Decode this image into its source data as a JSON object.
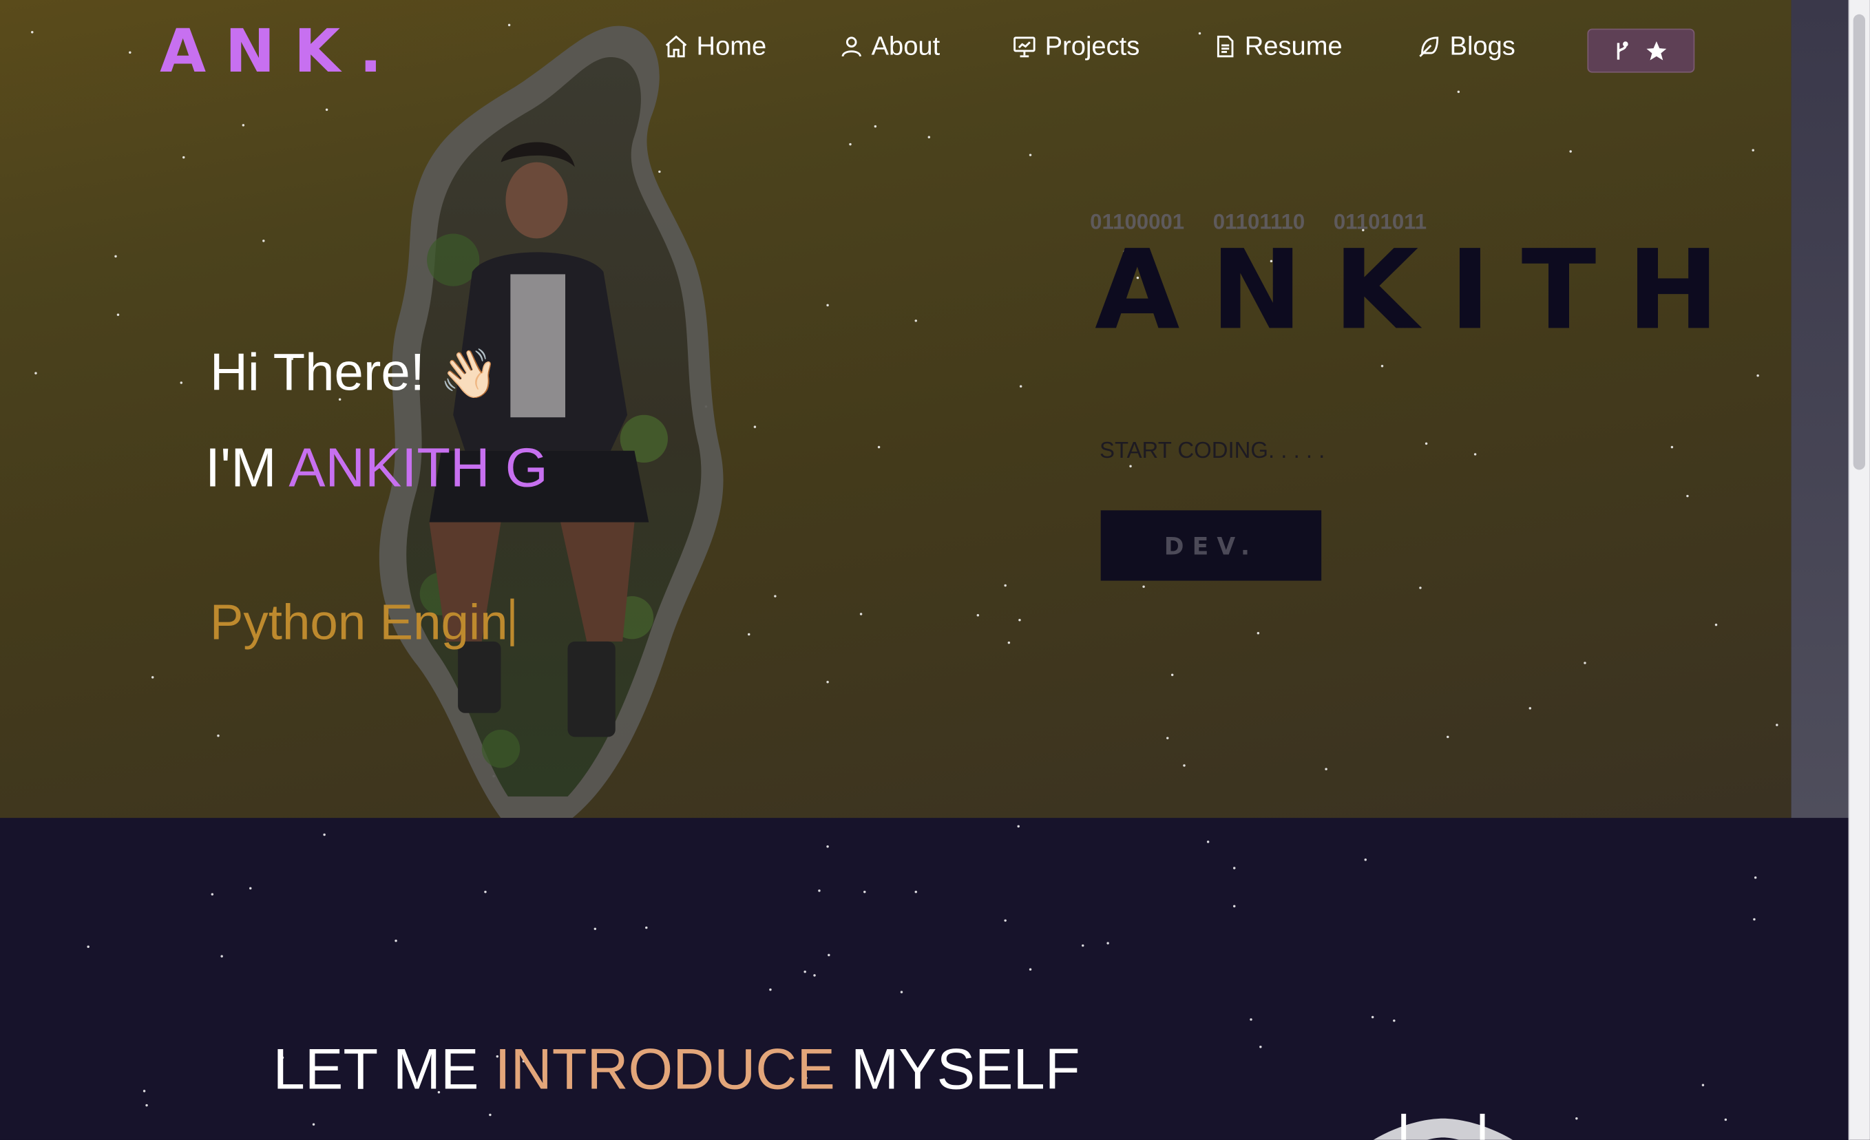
{
  "nav": {
    "logo": "ANK.",
    "items": [
      {
        "label": "Home",
        "icon": "home-icon"
      },
      {
        "label": "About",
        "icon": "user-icon"
      },
      {
        "label": "Projects",
        "icon": "presentation-icon"
      },
      {
        "label": "Resume",
        "icon": "document-icon"
      },
      {
        "label": "Blogs",
        "icon": "feather-icon"
      }
    ],
    "fork_button_icons": [
      "git-fork-icon",
      "star-icon"
    ]
  },
  "hero": {
    "greeting": "Hi There!",
    "wave_emoji": "👋🏻",
    "im_prefix": "I'M",
    "name": "ANKITH G",
    "typed_text": "Python Engin",
    "binary": [
      "01100001",
      "01101110",
      "01101011"
    ],
    "big_name": "ANKITH",
    "start_coding": "START CODING. . . . .",
    "dev_button": "DEV."
  },
  "intro": {
    "title_part1": "LET ME",
    "title_accent": "INTRODUCE",
    "title_part2": "MYSELF"
  },
  "colors": {
    "accent_purple": "#c770f0",
    "typed_gold": "#be8a2e",
    "intro_accent": "#e3a67a",
    "dark_bg": "#17132b"
  }
}
